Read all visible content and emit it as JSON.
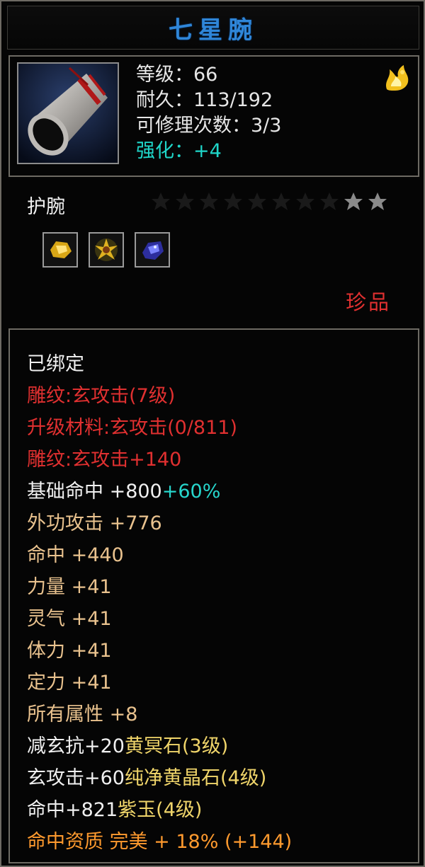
{
  "title": "七星腕",
  "colors": {
    "title": "#2f86d8",
    "white": "#f0f0f0",
    "red": "#e03030",
    "tan": "#e9c28e",
    "cyan": "#27d6cc",
    "yellow": "#f0d56a",
    "orange": "#ff9a2e",
    "border": "#6d6a63"
  },
  "header": {
    "stats": {
      "level_label": "等级：",
      "level_value": "66",
      "durability_label": "耐久：",
      "durability_value": "113/192",
      "repair_label": "可修理次数：",
      "repair_value": "3/3",
      "enhance_label": "强化：",
      "enhance_value": "+4"
    },
    "icon": "bracer-icon",
    "badge_icon": "golden-flame-icon"
  },
  "item_type": "护腕",
  "stars": {
    "total": 10,
    "filled": 2
  },
  "gems": [
    "yellow-gem-icon",
    "sun-gem-icon",
    "blue-gem-icon"
  ],
  "rarity": "珍品",
  "details": [
    {
      "name": "bind-status",
      "segments": [
        {
          "text": "已绑定",
          "color": "white"
        }
      ]
    },
    {
      "name": "engrave-line",
      "segments": [
        {
          "text": "雕纹:玄攻击(7级)",
          "color": "red"
        }
      ]
    },
    {
      "name": "upgrade-material-line",
      "segments": [
        {
          "text": "升级材料:玄攻击(0/811)",
          "color": "red"
        }
      ]
    },
    {
      "name": "engrave-bonus-line",
      "segments": [
        {
          "text": "雕纹:玄攻击+140",
          "color": "red"
        }
      ]
    },
    {
      "name": "base-accuracy-line",
      "segments": [
        {
          "text": "基础命中 +800 ",
          "color": "white"
        },
        {
          "text": "+60%",
          "color": "cyan"
        }
      ]
    },
    {
      "name": "external-attack-line",
      "segments": [
        {
          "text": "外功攻击 +776",
          "color": "tan"
        }
      ]
    },
    {
      "name": "accuracy-line",
      "segments": [
        {
          "text": "命中 +440",
          "color": "tan"
        }
      ]
    },
    {
      "name": "strength-line",
      "segments": [
        {
          "text": "力量 +41",
          "color": "tan"
        }
      ]
    },
    {
      "name": "spirit-line",
      "segments": [
        {
          "text": "灵气 +41",
          "color": "tan"
        }
      ]
    },
    {
      "name": "stamina-line",
      "segments": [
        {
          "text": "体力 +41",
          "color": "tan"
        }
      ]
    },
    {
      "name": "focus-line",
      "segments": [
        {
          "text": "定力 +41",
          "color": "tan"
        }
      ]
    },
    {
      "name": "all-attributes-line",
      "segments": [
        {
          "text": "所有属性 +8",
          "color": "tan"
        }
      ]
    },
    {
      "name": "gem-socket-1-line",
      "segments": [
        {
          "text": "减玄抗+20",
          "color": "white"
        },
        {
          "text": "黄冥石(3级)",
          "color": "yellow"
        }
      ]
    },
    {
      "name": "gem-socket-2-line",
      "segments": [
        {
          "text": "玄攻击+60",
          "color": "white"
        },
        {
          "text": "纯净黄晶石(4级)",
          "color": "yellow"
        }
      ]
    },
    {
      "name": "gem-socket-3-line",
      "segments": [
        {
          "text": "命中+821",
          "color": "white"
        },
        {
          "text": "紫玉(4级)",
          "color": "yellow"
        }
      ]
    },
    {
      "name": "accuracy-quality-line",
      "segments": [
        {
          "text": "命中资质 完美 + 18% (+144)",
          "color": "orange"
        }
      ]
    }
  ]
}
